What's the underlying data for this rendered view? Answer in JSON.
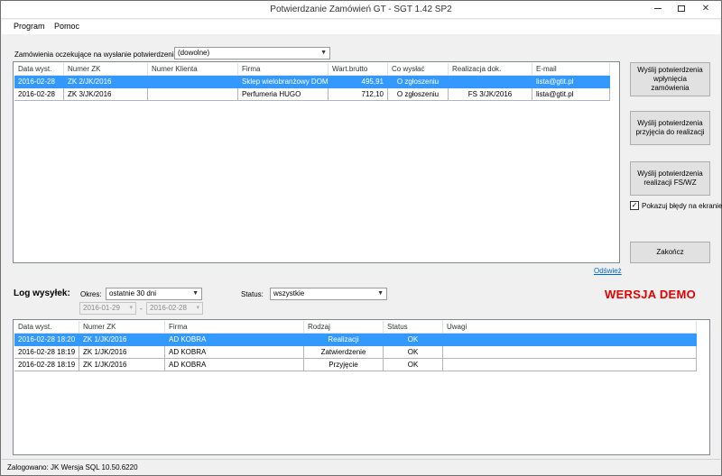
{
  "window": {
    "title": "Potwierdzanie Zamówień GT - SGT 1.42 SP2"
  },
  "menu": {
    "items": [
      "Program",
      "Pomoc"
    ]
  },
  "orders": {
    "label": "Zamówienia oczekujące na wysłanie potwierdzenia",
    "filter_value": "(dowolne)",
    "columns": [
      "Data wyst.",
      "Numer ZK",
      "Numer Klienta",
      "Firma",
      "Wart.brutto",
      "Co wysłać",
      "Realizacja dok.",
      "E-mail"
    ],
    "rows": [
      [
        "2016-02-28",
        "ZK 2/JK/2016",
        "",
        "Sklep wielobranżowy DOM...",
        "495,91",
        "O zgłoszeniu",
        "",
        "lista@gtit.pl"
      ],
      [
        "2016-02-28",
        "ZK 3/JK/2016",
        "",
        "Perfumeria HUGO",
        "712,10",
        "O zgłoszeniu",
        "FS 3/JK/2016",
        "lista@gtit.pl"
      ]
    ],
    "selected_row": 0
  },
  "actions": {
    "send_received": "Wyślij potwierdzenia wpłynięcia zamówienia",
    "send_accepted": "Wyślij potwierdzenia przyjęcia do realizacji",
    "send_realized": "Wyślij potwierdzenia realizacji FS/WZ",
    "show_errors_label": "Pokazuj błędy na ekranie",
    "show_errors_checked": true,
    "close": "Zakończ"
  },
  "refresh_link": "Odśwież",
  "log": {
    "title": "Log wysyłek:",
    "period_label": "Okres:",
    "period_value": "ostatnie 30 dni",
    "date_from": "2016-01-29",
    "date_to": "2016-02-28",
    "date_sep": "-",
    "status_label": "Status:",
    "status_value": "wszystkie",
    "columns": [
      "Data wyst.",
      "Numer ZK",
      "Firma",
      "Rodzaj",
      "Status",
      "Uwagi"
    ],
    "rows": [
      [
        "2016-02-28 18:20",
        "ZK 1/JK/2016",
        "AD KOBRA",
        "Realizacji",
        "OK",
        ""
      ],
      [
        "2016-02-28 18:19",
        "ZK 1/JK/2016",
        "AD KOBRA",
        "Zatwierdzenie",
        "OK",
        ""
      ],
      [
        "2016-02-28 18:19",
        "ZK 1/JK/2016",
        "AD KOBRA",
        "Przyjęcie",
        "OK",
        ""
      ]
    ],
    "selected_row": 0
  },
  "demo_label": "WERSJA DEMO",
  "status_bar": "Zalogowano: JK  Wersja SQL 10.50.6220"
}
